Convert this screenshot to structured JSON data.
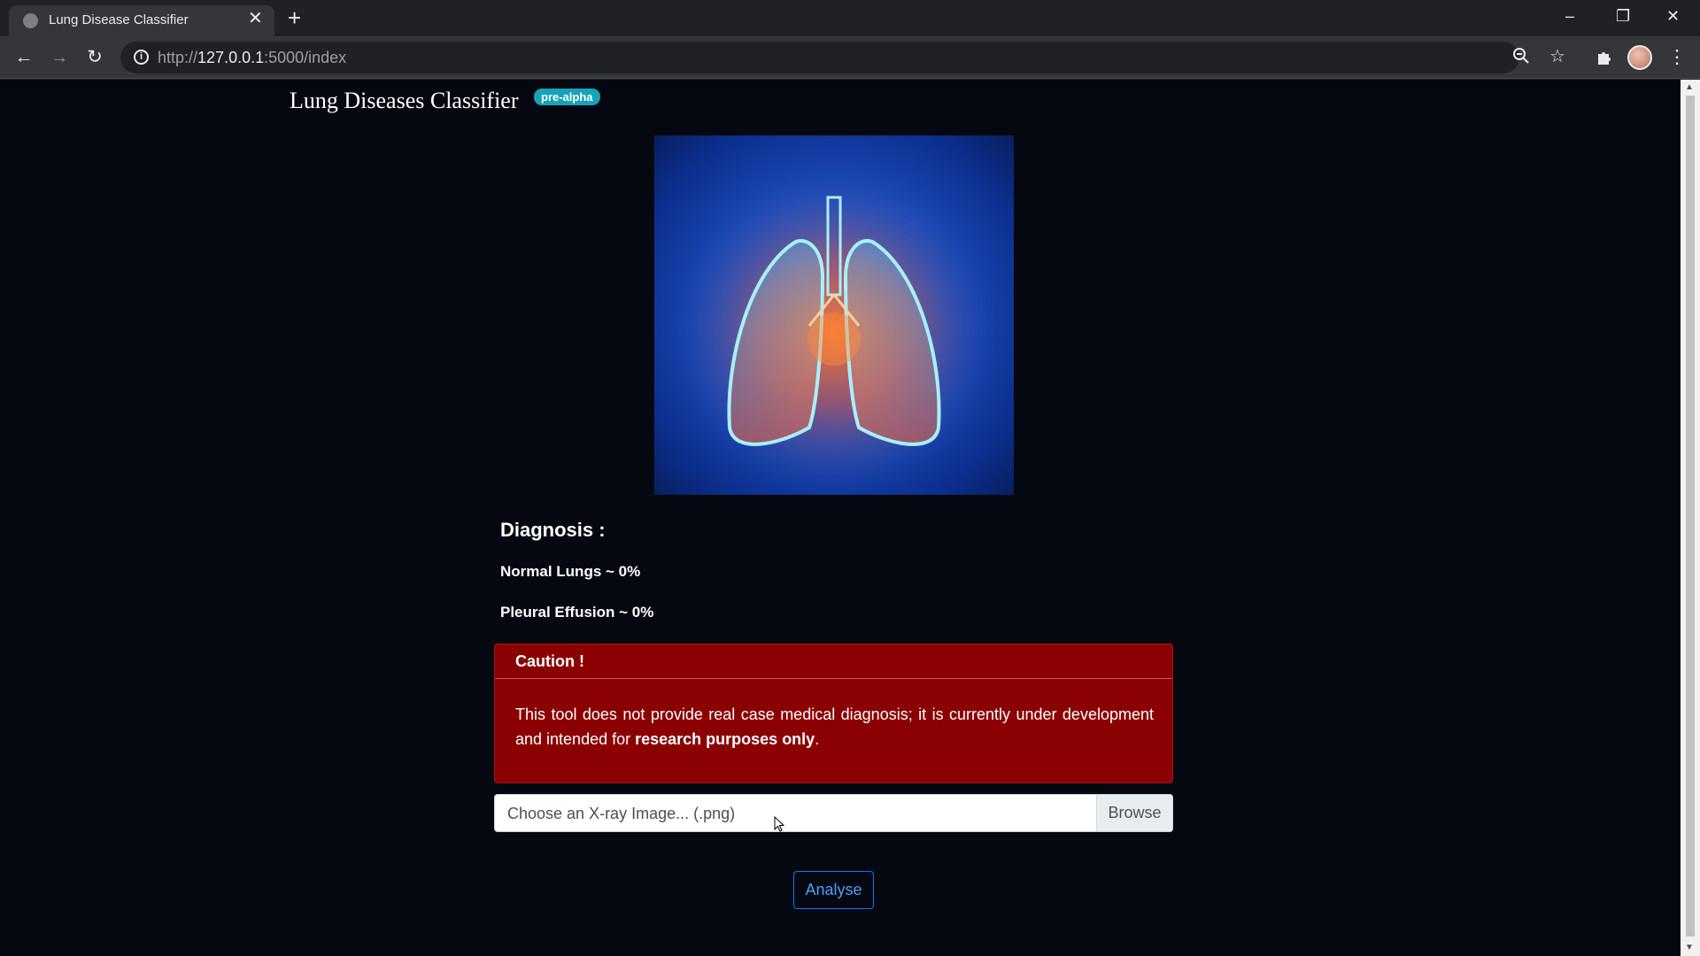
{
  "browser": {
    "tab_title": "Lung Disease Classifier",
    "url_scheme": "http://",
    "url_host": "127.0.0.1",
    "url_path": ":5000/index",
    "icons": {
      "tab_close": "close-icon",
      "new_tab": "plus-icon",
      "back": "back-arrow-icon",
      "forward": "forward-arrow-icon",
      "reload": "reload-icon",
      "site_info": "info-icon",
      "zoom": "zoom-icon",
      "bookmark": "star-icon",
      "extensions": "puzzle-icon",
      "menu": "kebab-menu-icon"
    }
  },
  "page": {
    "brand": "Lung Diseases Classifier",
    "badge": "pre-alpha",
    "diagnosis": {
      "title": "Diagnosis :",
      "results": [
        {
          "label": "Normal Lungs ~ 0%"
        },
        {
          "label": "Pleural Effusion ~ 0%"
        }
      ]
    },
    "caution": {
      "title": "Caution !",
      "body_prefix": "This tool does not provide real case medical diagnosis; it is currently under development and intended for ",
      "body_bold": "research purposes only",
      "body_suffix": "."
    },
    "file_input": {
      "label": "Choose an X-ray Image... (.png)",
      "browse": "Browse"
    },
    "analyse_button": "Analyse"
  },
  "colors": {
    "page_bg": "#050810",
    "alert_bg": "#8b0000",
    "badge_bg": "#17a2b8",
    "primary": "#007bff"
  }
}
